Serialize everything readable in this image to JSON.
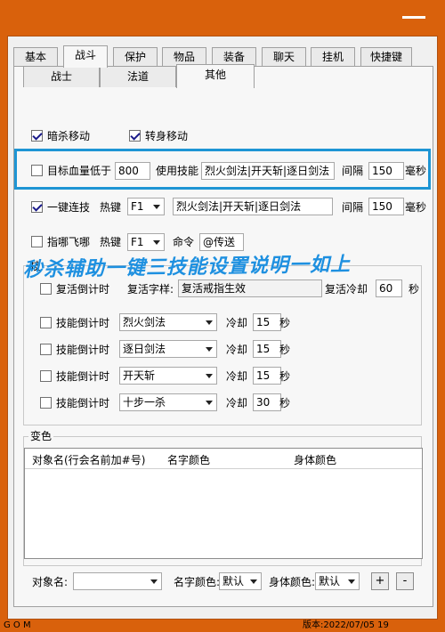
{
  "tabs": [
    "基本",
    "战斗",
    "保护",
    "物品",
    "装备",
    "聊天",
    "挂机",
    "快捷键"
  ],
  "subtabs": [
    "战士",
    "法道",
    "其他"
  ],
  "row1": {
    "cb1": "暗杀移动",
    "cb2": "转身移动"
  },
  "row2": {
    "label": "目标血量低于",
    "value": "800",
    "use_skill": "使用技能",
    "skills": "烈火剑法|开天斩|逐日剑法",
    "interval_label": "间隔",
    "interval": "150",
    "unit": "毫秒"
  },
  "row3": {
    "label": "一键连技",
    "hotkey_label": "热键",
    "hotkey": "F1",
    "skills": "烈火剑法|开天斩|逐日剑法",
    "interval_label": "间隔",
    "interval": "150",
    "unit": "毫秒"
  },
  "row4": {
    "label": "指哪飞哪",
    "hotkey_label": "热键",
    "hotkey": "F1",
    "cmd_label": "命令",
    "cmd": "@传送"
  },
  "overlay_text": "秒杀辅助一键三技能设置说明一如上",
  "group1": {
    "title": "技",
    "revive": {
      "label": "复活倒计时",
      "font_label": "复活字样:",
      "font_value": "复活戒指生效",
      "cd_label": "复活冷却",
      "cd": "60",
      "unit": "秒"
    },
    "skills": [
      {
        "label": "技能倒计时",
        "skill": "烈火剑法",
        "cd_label": "冷却",
        "cd": "15",
        "unit": "秒"
      },
      {
        "label": "技能倒计时",
        "skill": "逐日剑法",
        "cd_label": "冷却",
        "cd": "15",
        "unit": "秒"
      },
      {
        "label": "技能倒计时",
        "skill": "开天斩",
        "cd_label": "冷却",
        "cd": "15",
        "unit": "秒"
      },
      {
        "label": "技能倒计时",
        "skill": "十步一杀",
        "cd_label": "冷却",
        "cd": "30",
        "unit": "秒"
      }
    ]
  },
  "group2": {
    "title": "变色",
    "columns": [
      "对象名(行会名前加#号)",
      "名字颜色",
      "身体颜色"
    ]
  },
  "bottom": {
    "obj_label": "对象名:",
    "name_color_label": "名字颜色:",
    "name_color": "默认",
    "body_color_label": "身体颜色:",
    "body_color": "默认",
    "add": "+",
    "remove": "-"
  },
  "status": {
    "left": "G O M",
    "version": "版本:2022/07/05 19"
  },
  "colors": {
    "frame": "#d9610c",
    "highlight": "#1e95d4",
    "overlay": "#1e90e0"
  }
}
